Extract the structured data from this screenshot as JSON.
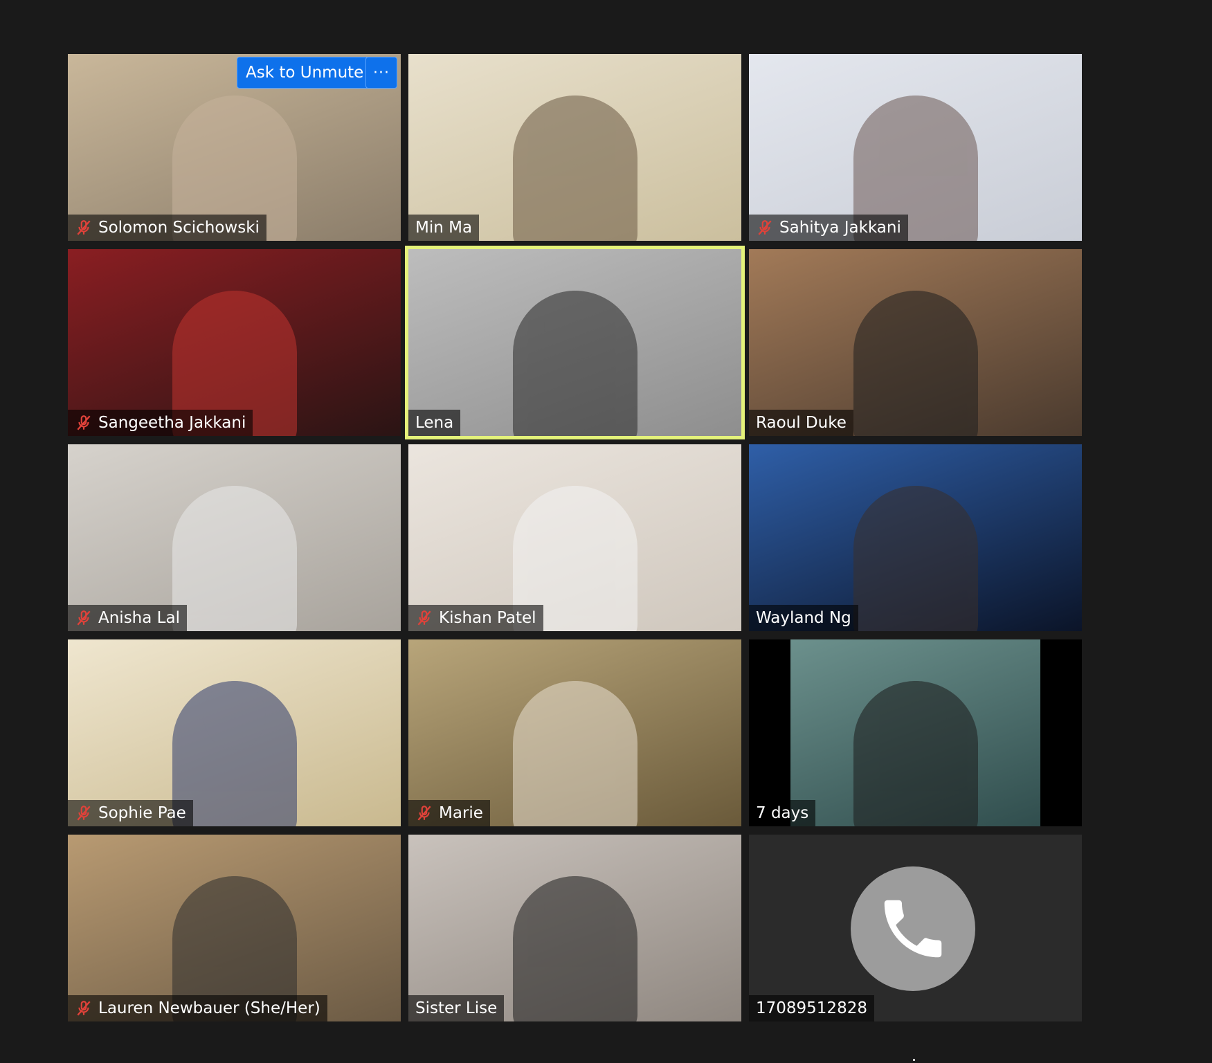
{
  "gallery": {
    "ask_to_unmute_label": "Ask to Unmute",
    "more_label": "···",
    "tiles": [
      {
        "name": "Solomon Scichowski",
        "muted": true,
        "bg": "#8b7d6a",
        "bg2": "#c9b79a",
        "fig": "#c7b39c"
      },
      {
        "name": "Min Ma",
        "muted": false,
        "bg": "#cbbf9e",
        "bg2": "#e8e0cc",
        "fig": "#6b5a44"
      },
      {
        "name": "Sahitya Jakkani",
        "muted": true,
        "bg": "#c9cdd6",
        "bg2": "#e4e7ee",
        "fig": "#6d5a55"
      },
      {
        "name": "Sangeetha Jakkani",
        "muted": true,
        "bg": "#2a1414",
        "bg2": "#8a1e22",
        "fig": "#c0342f"
      },
      {
        "name": "Lena",
        "muted": false,
        "speaking": true,
        "bg": "#8e8e8e",
        "bg2": "#bdbdbd",
        "fig": "#2a2a2a"
      },
      {
        "name": "Raoul Duke",
        "muted": false,
        "bg": "#4a3a2e",
        "bg2": "#a27a58",
        "fig": "#1f1f1f"
      },
      {
        "name": "Anisha Lal",
        "muted": true,
        "bg": "#a8a39c",
        "bg2": "#d6d2cc",
        "fig": "#e9e9e9"
      },
      {
        "name": "Kishan Patel",
        "muted": true,
        "bg": "#cfc7bd",
        "bg2": "#ebe5de",
        "fig": "#f4f4f4"
      },
      {
        "name": "Wayland Ng",
        "muted": false,
        "bg": "#0b1428",
        "bg2": "#2f5fa8",
        "fig": "#3a2f2a"
      },
      {
        "name": "Sophie Pae",
        "muted": true,
        "bg": "#c9b98f",
        "bg2": "#efe6cf",
        "fig": "#2f3c6e"
      },
      {
        "name": "Marie",
        "muted": true,
        "bg": "#6a5a3a",
        "bg2": "#b8a57a",
        "fig": "#e8dfd0"
      },
      {
        "name": "7 days",
        "muted": false,
        "letterbox": true,
        "bg": "#2d4a4a",
        "bg2": "#6f9490",
        "fig": "#1b1b1b"
      },
      {
        "name": "Lauren Newbauer (She/Her)",
        "muted": true,
        "bg": "#6b5a44",
        "bg2": "#b89a72",
        "fig": "#2e2e2e"
      },
      {
        "name": "Sister Lise",
        "muted": false,
        "bg": "#8f8780",
        "bg2": "#c9c2bc",
        "fig": "#1f1f1f"
      },
      {
        "name": "17089512828",
        "muted": false,
        "phone": true,
        "bg": "#2b2b2b",
        "bg2": "#2b2b2b",
        "fig": "#2b2b2b"
      }
    ]
  },
  "colors": {
    "accent_blue": "#0e71eb",
    "speaking_outline": "#e4f27a",
    "muted_red": "#e0423a"
  }
}
